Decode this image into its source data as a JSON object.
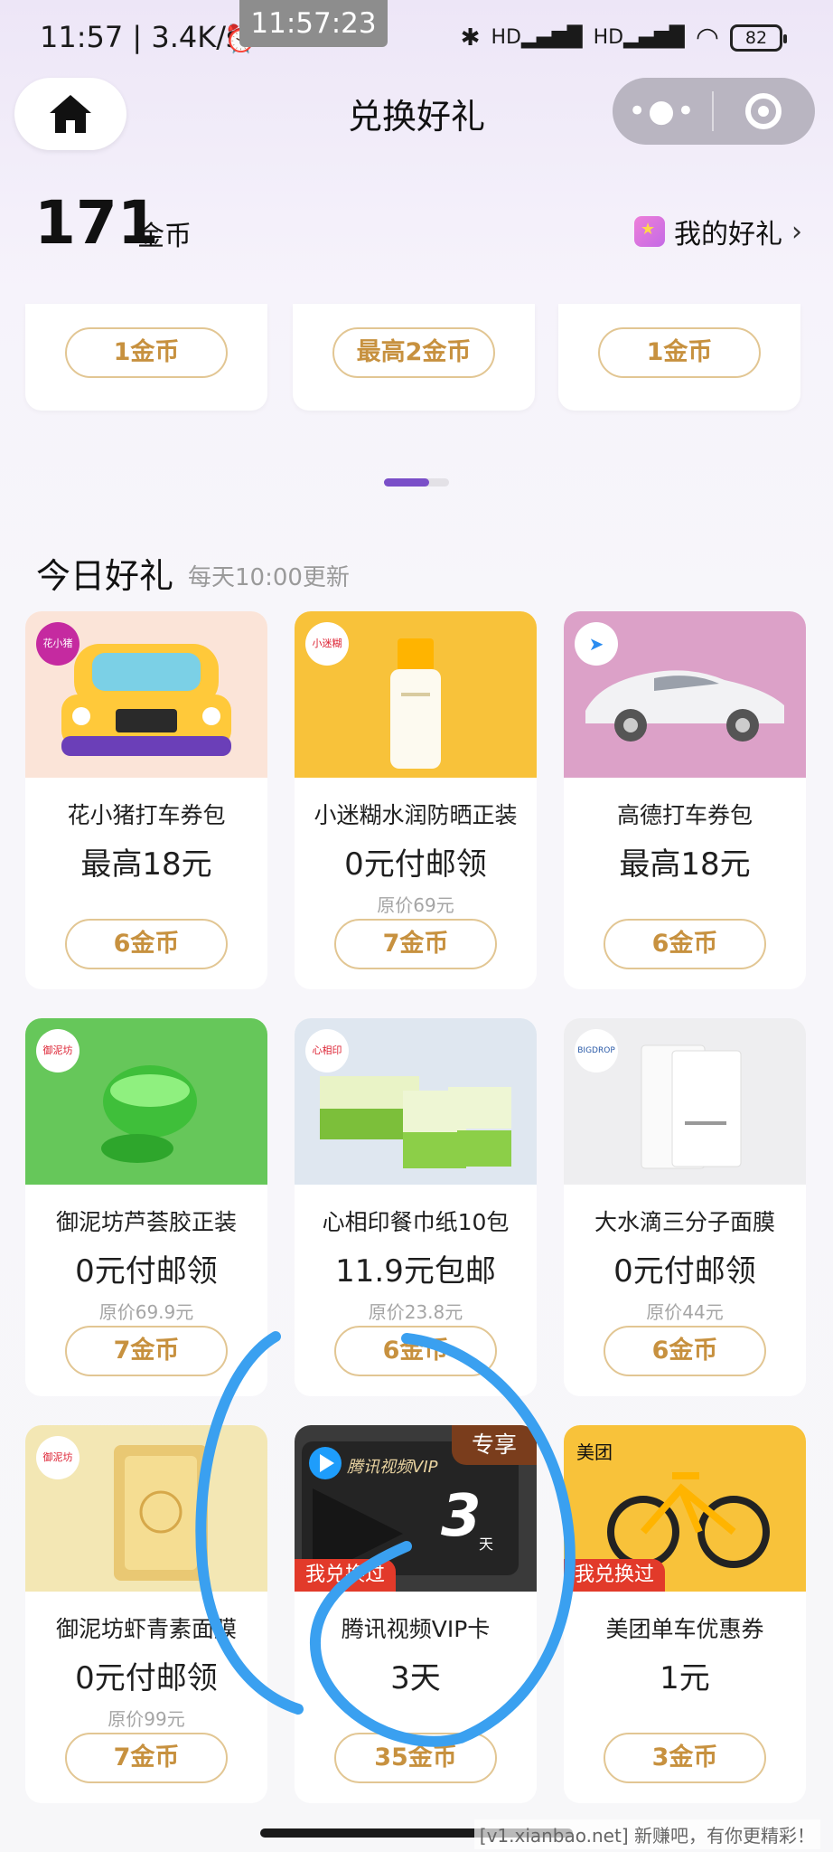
{
  "status_bar": {
    "time": "11:57 | 3.4K/s",
    "clock_overlay": "11:57:23",
    "signal_label": "HD",
    "battery": "82"
  },
  "nav": {
    "title": "兑换好礼"
  },
  "coins": {
    "amount": "171",
    "unit": "金币",
    "my_gifts_label": "我的好礼"
  },
  "carousel": {
    "buttons": [
      "1金币",
      "最高2金币",
      "1金币"
    ]
  },
  "section": {
    "title": "今日好礼",
    "subtitle": "每天10:00更新"
  },
  "products": [
    {
      "name": "花小猪打车券包",
      "price": "最高18元",
      "original": "",
      "cost": "6金币",
      "brand": "花小猪"
    },
    {
      "name": "小迷糊水润防晒正装",
      "price": "0元付邮领",
      "original": "原价69元",
      "cost": "7金币",
      "brand": "小迷糊"
    },
    {
      "name": "高德打车券包",
      "price": "最高18元",
      "original": "",
      "cost": "6金币",
      "brand": "高德"
    },
    {
      "name": "御泥坊芦荟胶正装",
      "price": "0元付邮领",
      "original": "原价69.9元",
      "cost": "7金币",
      "brand": "御泥坊"
    },
    {
      "name": "心相印餐巾纸10包",
      "price": "11.9元包邮",
      "original": "原价23.8元",
      "cost": "6金币",
      "brand": "心相印"
    },
    {
      "name": "大水滴三分子面膜",
      "price": "0元付邮领",
      "original": "原价44元",
      "cost": "6金币",
      "brand": "BIGDROP"
    },
    {
      "name": "御泥坊虾青素面膜",
      "price": "0元付邮领",
      "original": "原价99元",
      "cost": "7金币",
      "brand": "御泥坊"
    },
    {
      "name": "腾讯视频VIP卡",
      "price": "3天",
      "original": "",
      "cost": "35金币",
      "brand": "腾讯视频VIP",
      "tag": "专享",
      "badge": "我兑换过",
      "days": "3",
      "days_unit": "天"
    },
    {
      "name": "美团单车优惠券",
      "price": "1元",
      "original": "",
      "cost": "3金币",
      "brand": "美团",
      "badge": "我兑换过"
    }
  ],
  "watermark": "[v1.xianbao.net] 新赚吧，有你更精彩！",
  "colors": {
    "accent_purple": "#7a4fc8",
    "gold": "#c7913f",
    "annotation_blue": "#3aa0f0"
  }
}
